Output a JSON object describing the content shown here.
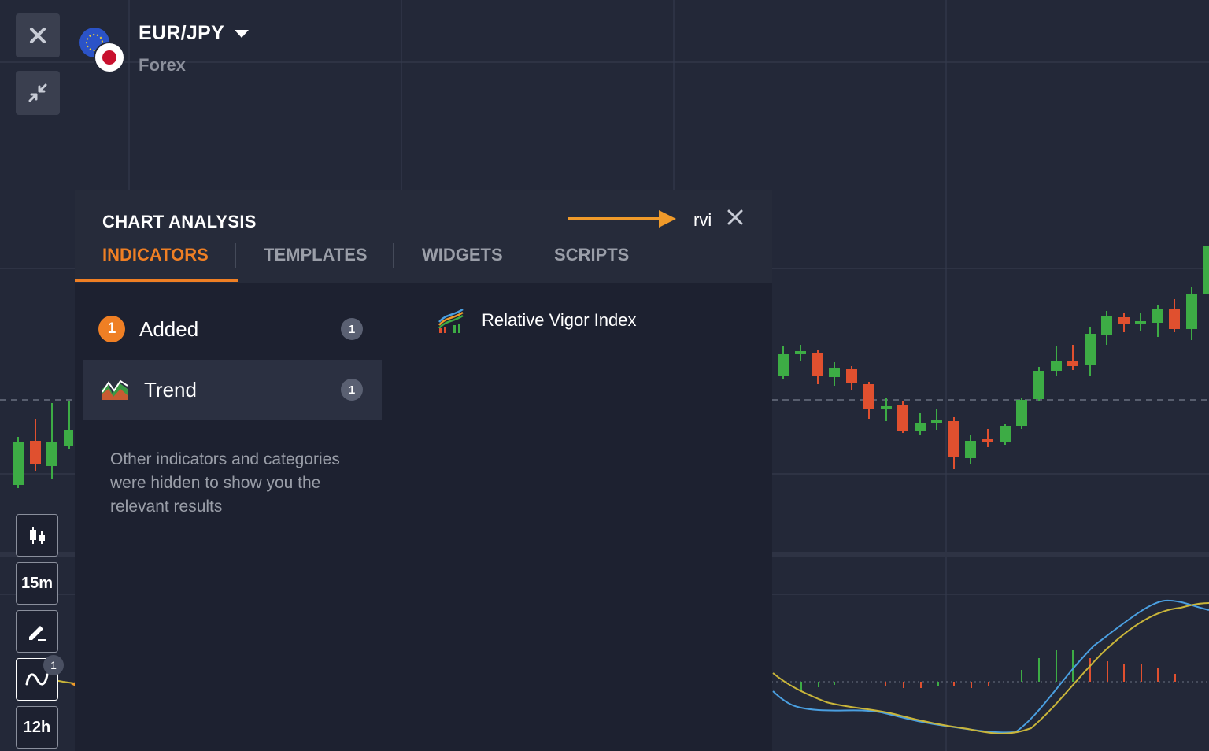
{
  "header": {
    "pair": "EUR/JPY",
    "category": "Forex"
  },
  "toolbar": {
    "close_icon": "close-icon",
    "collapse_icon": "collapse-icon",
    "chart_type_icon": "candles-icon",
    "timeframe_1": "15m",
    "draw_icon": "pencil-icon",
    "indicators_icon": "wave-icon",
    "indicators_badge": "1",
    "timeframe_2": "12h"
  },
  "panel": {
    "title": "CHART ANALYSIS",
    "search_value": "rvi",
    "tabs": [
      {
        "label": "INDICATORS",
        "active": true
      },
      {
        "label": "TEMPLATES",
        "active": false
      },
      {
        "label": "WIDGETS",
        "active": false
      },
      {
        "label": "SCRIPTS",
        "active": false
      }
    ],
    "categories": [
      {
        "label": "Added",
        "count": "1",
        "marker": "1"
      },
      {
        "label": "Trend",
        "count": "1"
      }
    ],
    "hint": "Other indicators and categories were hidden to show you the relevant results",
    "results": [
      {
        "label": "Relative Vigor Index",
        "icon": "rvi-indicator-icon"
      }
    ]
  },
  "colors": {
    "accent": "#ef7f24",
    "candle_up": "#3dac45",
    "candle_down": "#e0502f",
    "background": "#232838"
  }
}
